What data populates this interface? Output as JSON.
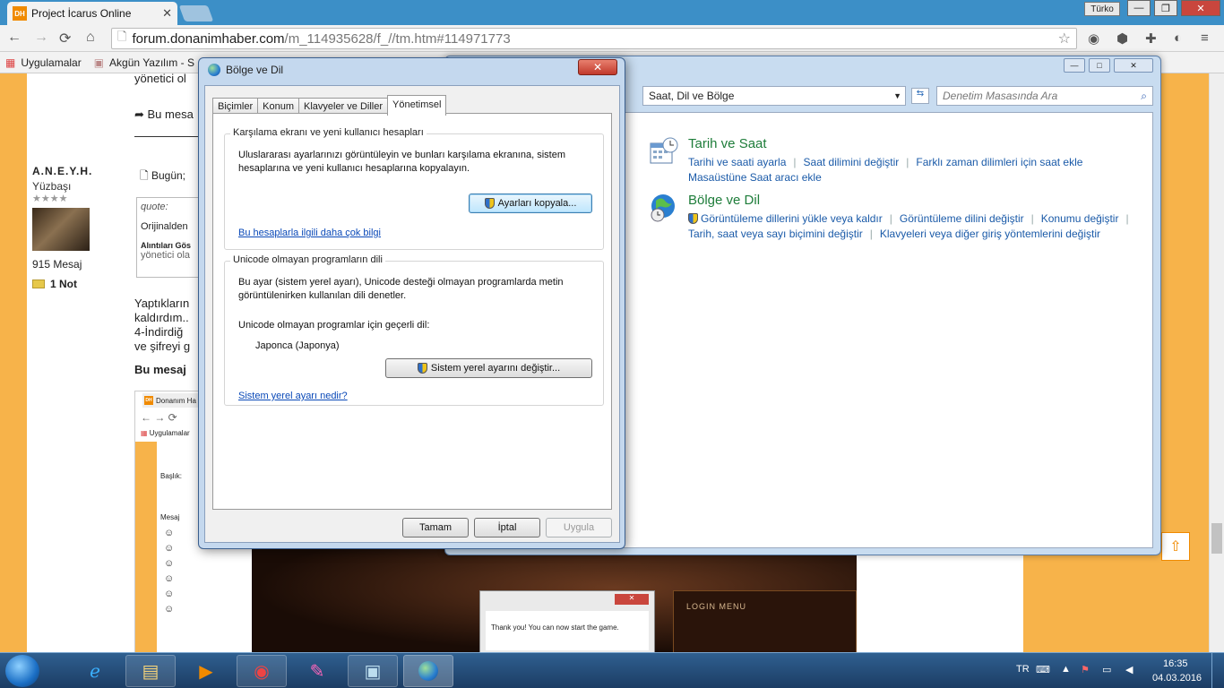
{
  "browser": {
    "tab_title": "Project İcarus Online",
    "tab_favicon": "DH",
    "user_chip": "Türko",
    "url_host": "forum.donanimhaber.com",
    "url_path": "/m_114935628/f_//tm.htm#114971773",
    "bookmarks": [
      "Uygulamalar",
      "Akgün Yazılım - S"
    ]
  },
  "forum": {
    "user": {
      "name": "A.N.E.Y.H.",
      "rank": "Yüzbaşı",
      "stars": "★★★★",
      "messages": "915 Mesaj",
      "note": "1 Not"
    },
    "frag_top1": "yönetici ol",
    "frag_reply": "Bu mesa",
    "frag_today": "Bugün;",
    "quote_label": "quote:",
    "quote_text": "Orijinalden",
    "quote_cite": "Alıntıları Gös",
    "quote_text2": "yönetici ola",
    "body1": "Yaptıkların",
    "body2": "kaldırdım..",
    "body3": "4-İndirdiğ",
    "body4": "ve şifreyi g",
    "body5": "Bu mesaj",
    "embedded_tab": "Donanım Ha",
    "embedded_bookmarks": "Uygulamalar",
    "embedded_label_title": "Başlık:",
    "embedded_label_msg": "Mesaj",
    "game_thanks": "Thank you! You can now start the game.",
    "game_login": "LOGIN MENU"
  },
  "control_panel": {
    "address": "Saat, Dil ve Bölge",
    "search_placeholder": "Denetim Masasında Ara",
    "group1": {
      "title": "Tarih ve Saat",
      "links": [
        "Tarihi ve saati ayarla",
        "Saat dilimini değiştir",
        "Farklı zaman dilimleri için saat ekle",
        "Masaüstüne Saat aracı ekle"
      ]
    },
    "group2": {
      "title": "Bölge ve Dil",
      "links": [
        "Görüntüleme dillerini yükle veya kaldır",
        "Görüntüleme dilini değiştir",
        "Konumu değiştir",
        "Tarih, saat veya sayı biçimini değiştir",
        "Klavyeleri veya diğer giriş yöntemlerini değiştir"
      ]
    }
  },
  "dialog": {
    "title": "Bölge ve Dil",
    "close_label": "✕",
    "tabs": [
      "Biçimler",
      "Konum",
      "Klavyeler ve Diller",
      "Yönetimsel"
    ],
    "welcome": {
      "legend": "Karşılama ekranı ve yeni kullanıcı hesapları",
      "description": "Uluslararası ayarlarınızı görüntüleyin ve bunları karşılama ekranına, sistem hesaplarına ve yeni kullanıcı hesaplarına kopyalayın.",
      "copy_button": "Ayarları kopyala...",
      "link": "Bu hesaplarla ilgili daha çok bilgi"
    },
    "unicode": {
      "legend": "Unicode olmayan programların dili",
      "description": "Bu ayar (sistem yerel ayarı), Unicode desteği olmayan programlarda metin görüntülenirken kullanılan dili denetler.",
      "current_label": "Unicode olmayan programlar için geçerli dil:",
      "current_value": "Japonca (Japonya)",
      "change_button": "Sistem yerel ayarını değiştir...",
      "link": "Sistem yerel ayarı nedir?"
    },
    "ok": "Tamam",
    "cancel": "İptal",
    "apply": "Uygula"
  },
  "taskbar": {
    "lang": "TR",
    "time": "16:35",
    "date": "04.03.2016"
  }
}
